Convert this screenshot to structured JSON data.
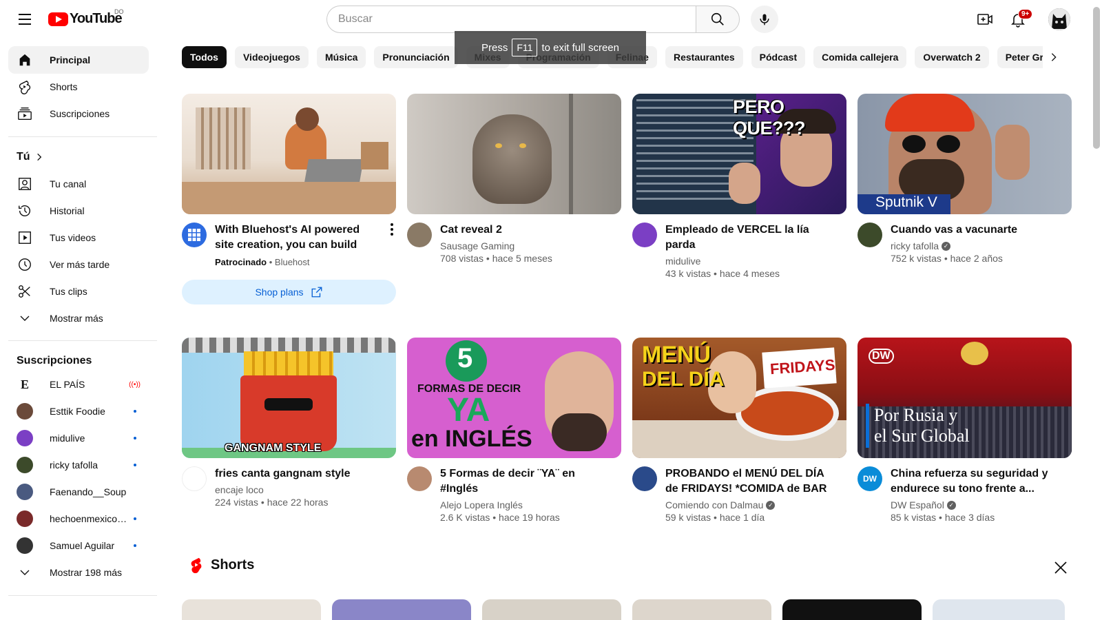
{
  "header": {
    "logo_text": "YouTube",
    "logo_country": "DO",
    "search_placeholder": "Buscar",
    "notif_badge": "9+"
  },
  "fullscreen_toast": {
    "prefix": "Press",
    "key": "F11",
    "suffix": "to exit full screen"
  },
  "sidebar": {
    "main": [
      {
        "label": "Principal",
        "icon": "home-icon",
        "active": true
      },
      {
        "label": "Shorts",
        "icon": "shorts-icon"
      },
      {
        "label": "Suscripciones",
        "icon": "subscriptions-icon"
      }
    ],
    "you_heading": "Tú",
    "you_items": [
      {
        "label": "Tu canal",
        "icon": "channel-icon"
      },
      {
        "label": "Historial",
        "icon": "history-icon"
      },
      {
        "label": "Tus videos",
        "icon": "videos-icon"
      },
      {
        "label": "Ver más tarde",
        "icon": "watch-later-icon"
      },
      {
        "label": "Tus clips",
        "icon": "clips-icon"
      },
      {
        "label": "Mostrar más",
        "icon": "chevron-down-icon"
      }
    ],
    "subs_heading": "Suscripciones",
    "subs": [
      {
        "label": "EL PAÍS",
        "color": "#ffffff",
        "live": true
      },
      {
        "label": "Esttik Foodie",
        "color": "#6b4a3a"
      },
      {
        "label": "midulive",
        "color": "#7b3fc4"
      },
      {
        "label": "ricky tafolla",
        "color": "#3c4a2a"
      },
      {
        "label": "Faenando__Soup",
        "color": "#4a5a80"
      },
      {
        "label": "hechoenmexicoo...",
        "color": "#7a2a2a"
      },
      {
        "label": "Samuel Aguilar",
        "color": "#333333"
      }
    ],
    "show_more_subs": "Mostrar 198 más"
  },
  "chips": [
    "Todos",
    "Videojuegos",
    "Música",
    "Pronunciación",
    "Mixes",
    "Programación",
    "Felinae",
    "Restaurantes",
    "Pódcast",
    "Comida callejera",
    "Overwatch 2",
    "Peter Griffin"
  ],
  "videos": [
    {
      "title": "With Bluehost's AI powered site creation, you can build a...",
      "sponsored_label": "Patrocinado",
      "channel": "Bluehost",
      "cta": "Shop plans"
    },
    {
      "title": "Cat reveal 2",
      "channel": "Sausage Gaming",
      "stats": "708 vistas • hace 5 meses"
    },
    {
      "title": "Empleado de VERCEL la lía parda",
      "channel": "midulive",
      "stats": "43 k vistas • hace 4 meses",
      "thumb_text": "PERO QUE???"
    },
    {
      "title": "Cuando vas a vacunarte",
      "channel": "ricky tafolla",
      "verified": true,
      "stats": "752 k vistas • hace 2 años",
      "thumb_text": "Sputnik V"
    },
    {
      "title": "fries canta gangnam style",
      "channel": "encaje loco",
      "stats": "224 vistas • hace 22 horas",
      "thumb_text": "GANGNAM STYLE"
    },
    {
      "title": "5 Formas de decir ¨YA¨ en #Inglés",
      "channel": "Alejo Lopera Inglés",
      "stats": "2.6 K vistas • hace 19 horas",
      "thumb_lines": [
        "5",
        "FORMAS DE DECIR",
        "YA",
        "en INGLÉS"
      ]
    },
    {
      "title": "PROBANDO el MENÚ DEL DÍA de FRIDAYS! *COMIDA de BAR en...",
      "channel": "Comiendo con Dalmau",
      "verified": true,
      "stats": "59 k vistas • hace 1 día",
      "thumb_lines": [
        "MENÚ",
        "DEL DÍA",
        "FRIDAYS"
      ]
    },
    {
      "title": "China refuerza su seguridad y endurece su tono frente a...",
      "channel": "DW Español",
      "verified": true,
      "stats": "85 k vistas • hace 3 días",
      "thumb_lines": [
        "DW",
        "Por Rusia y",
        "el Sur Global"
      ]
    }
  ],
  "shorts": {
    "heading": "Shorts"
  },
  "colors": {
    "accent_red": "#ff0000",
    "link_blue": "#065fd4"
  }
}
